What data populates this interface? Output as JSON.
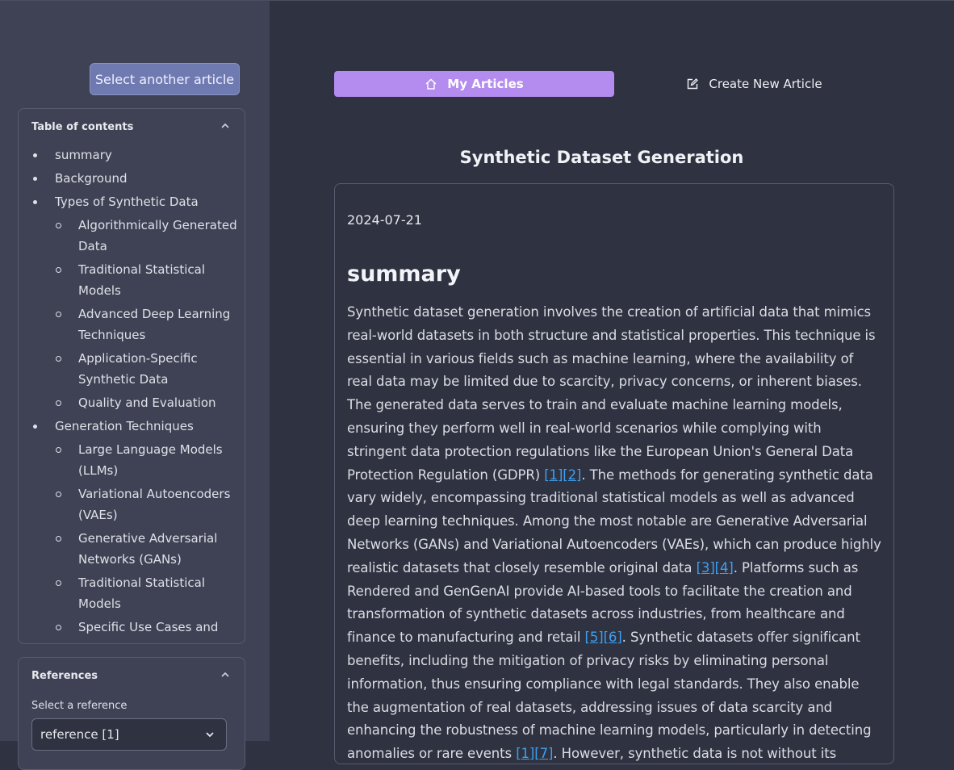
{
  "sidebar": {
    "select_another_label": "Select another article",
    "toc": {
      "title": "Table of contents",
      "items": [
        {
          "label": "summary",
          "level": 1
        },
        {
          "label": "Background",
          "level": 1
        },
        {
          "label": "Types of Synthetic Data",
          "level": 1
        },
        {
          "label": "Algorithmically Generated Data",
          "level": 2
        },
        {
          "label": "Traditional Statistical Models",
          "level": 2
        },
        {
          "label": "Advanced Deep Learning Techniques",
          "level": 2
        },
        {
          "label": "Application-Specific Synthetic Data",
          "level": 2
        },
        {
          "label": "Quality and Evaluation",
          "level": 2
        },
        {
          "label": "Generation Techniques",
          "level": 1
        },
        {
          "label": "Large Language Models (LLMs)",
          "level": 2
        },
        {
          "label": "Variational Autoencoders (VAEs)",
          "level": 2
        },
        {
          "label": "Generative Adversarial Networks (GANs)",
          "level": 2
        },
        {
          "label": "Traditional Statistical Models",
          "level": 2
        },
        {
          "label": "Specific Use Cases and",
          "level": 2
        }
      ]
    },
    "references": {
      "title": "References",
      "select_label": "Select a reference",
      "selected": "reference [1]"
    }
  },
  "nav": {
    "my_articles": "My Articles",
    "create_new": "Create New Article"
  },
  "article": {
    "title": "Synthetic Dataset Generation",
    "date": "2024-07-21",
    "section": "summary",
    "paragraph": [
      {
        "t": "Synthetic dataset generation involves the creation of artificial data that mimics real-world datasets in both structure and statistical properties. This technique is essential in various fields such as machine learning, where the availability of real data may be limited due to scarcity, privacy concerns, or inherent biases. The generated data serves to train and evaluate machine learning models, ensuring they perform well in real-world scenarios while complying with stringent data protection regulations like the European Union's General Data Protection Regulation (GDPR) "
      },
      {
        "c": "[1]"
      },
      {
        "c": "[2]"
      },
      {
        "t": ". The methods for generating synthetic data vary widely, encompassing traditional statistical models as well as advanced deep learning techniques. Among the most notable are Generative Adversarial Networks (GANs) and Variational Autoencoders (VAEs), which can produce highly realistic datasets that closely resemble original data "
      },
      {
        "c": "[3]"
      },
      {
        "c": "[4]"
      },
      {
        "t": ". Platforms such as Rendered and GenGenAI provide AI-based tools to facilitate the creation and transformation of synthetic datasets across industries, from healthcare and finance to manufacturing and retail "
      },
      {
        "c": "[5]"
      },
      {
        "c": "[6]"
      },
      {
        "t": ". Synthetic datasets offer significant benefits, including the mitigation of privacy risks by eliminating personal information, thus ensuring compliance with legal standards. They also enable the augmentation of real datasets, addressing issues of data scarcity and enhancing the robustness of machine learning models, particularly in detecting anomalies or rare events "
      },
      {
        "c": "[1]"
      },
      {
        "c": "[7]"
      },
      {
        "t": ". However, synthetic data is not without its challenges. Issues such as potential biases and the difficulty of"
      }
    ]
  },
  "colors": {
    "accent": "#b48bee",
    "citation": "#3ea0f0",
    "sidebar_bg": "#3e4254",
    "main_bg": "#2f3241"
  }
}
